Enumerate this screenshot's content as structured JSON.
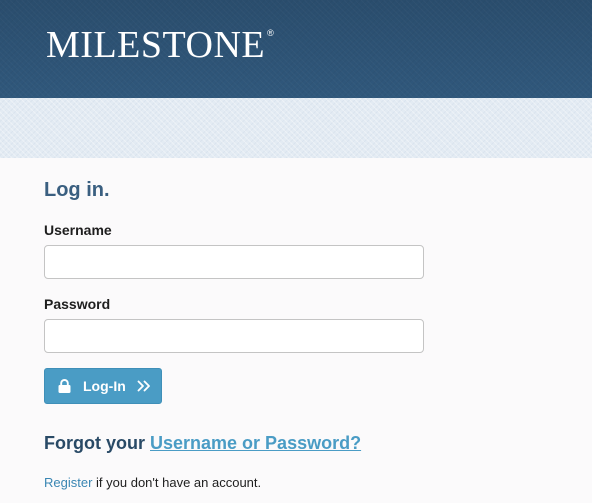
{
  "header": {
    "logo_text": "MILESTONE",
    "registered_mark": "®"
  },
  "login": {
    "title": "Log in.",
    "username_label": "Username",
    "username_value": "",
    "password_label": "Password",
    "password_value": "",
    "button_label": "Log-In",
    "button_icon": "lock-icon",
    "button_trailing_icon": "chevrons-right-icon",
    "accent_color": "#4a9cc5"
  },
  "forgot": {
    "prefix": "Forgot your ",
    "link_text": "Username or Password?"
  },
  "register": {
    "link_text": "Register",
    "suffix": " if you don't have an account."
  },
  "colors": {
    "header": "#2c4e6d",
    "band": "#e3ebf3",
    "title": "#3a5f80"
  }
}
